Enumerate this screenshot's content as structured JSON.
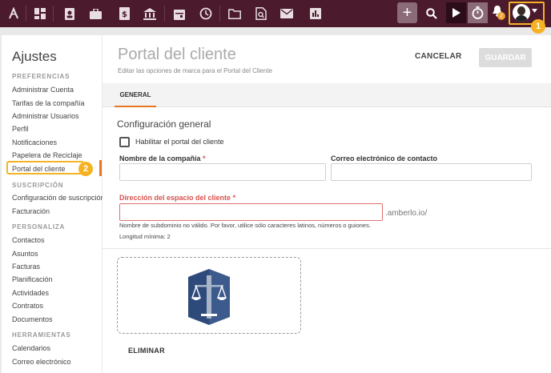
{
  "topbar": {
    "icons": [
      "logo-icon",
      "dashboard-icon",
      "contacts-icon",
      "briefcase-icon",
      "invoice-icon",
      "bank-icon",
      "calendar-icon",
      "history-icon",
      "folder-icon",
      "document-search-icon",
      "mail-icon",
      "reports-icon"
    ],
    "plus_label": "+",
    "bell_badge": "2",
    "accent": "#f5b324",
    "bar_color": "#4b1a2c"
  },
  "callouts": {
    "one": "1",
    "two": "2"
  },
  "sidebar": {
    "title": "Ajustes",
    "sections": {
      "preferencias": "PREFERENCIAS",
      "suscripcion": "SUSCRIPCIÓN",
      "personaliza": "PERSONALIZA",
      "herramientas": "HERRAMIENTAS"
    },
    "items": {
      "administrar_cuenta": "Administrar Cuenta",
      "tarifas": "Tarifas de la compañía",
      "administrar_usuarios": "Administrar Usuarios",
      "perfil": "Perfil",
      "notificaciones": "Notificaciones",
      "papelera": "Papelera de Reciclaje",
      "portal": "Portal del cliente",
      "config_suscripcion": "Configuración de suscripción",
      "facturacion": "Facturación",
      "contactos": "Contactos",
      "asuntos": "Asuntos",
      "facturas": "Facturas",
      "planificacion": "Planificación",
      "actividades": "Actividades",
      "contratos": "Contratos",
      "documentos": "Documentos",
      "calendarios": "Calendarios",
      "correo": "Correo electrónico"
    }
  },
  "header": {
    "title": "Portal del cliente",
    "subtitle": "Editar las opciones de marca para el Portal del Cliente",
    "cancel_label": "CANCELAR",
    "save_label": "GUARDAR"
  },
  "tabs": {
    "general": "GENERAL"
  },
  "form": {
    "section_title": "Configuración general",
    "enable_label": "Habilitar el portal del cliente",
    "enable_checked": false,
    "company_label": "Nombre de la compañía",
    "company_value": "",
    "email_label": "Correo electrónico de contacto",
    "email_value": "",
    "space_label": "Dirección del espacio del cliente",
    "space_value": "",
    "space_suffix": ".amberlo.io/",
    "required_mark": "*",
    "error_text": "Nombre de subdominio no válido. Por favor, utilice sólo caracteres latinos, números o guiones.",
    "min_length": "Longitud mínima: 2"
  },
  "logo": {
    "delete_label": "ELIMINAR",
    "primary": "#2e4a7a",
    "secondary": "#a8b4c8"
  }
}
